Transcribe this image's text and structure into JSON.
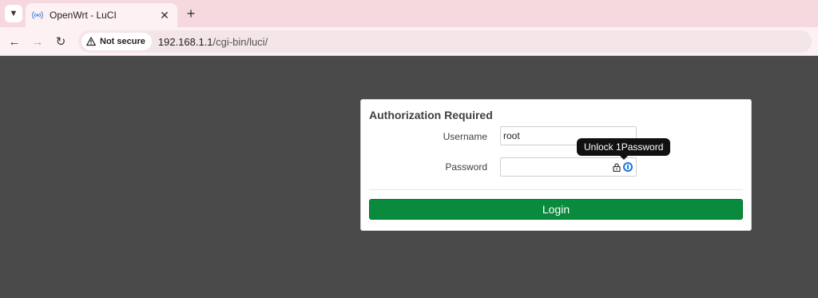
{
  "browser": {
    "tab": {
      "title": "OpenWrt - LuCI",
      "favicon": "radio-waves-icon"
    },
    "omnibox": {
      "security_label": "Not secure",
      "url_host": "192.168.1.1",
      "url_path": "/cgi-bin/luci/"
    }
  },
  "login": {
    "title": "Authorization Required",
    "username_label": "Username",
    "username_value": "root",
    "password_label": "Password",
    "password_value": "",
    "tooltip": "Unlock 1Password",
    "login_button": "Login"
  },
  "colors": {
    "page_background": "#4a4a4a",
    "login_button": "#0a8a3c",
    "tabbar": "#f6d9de"
  }
}
